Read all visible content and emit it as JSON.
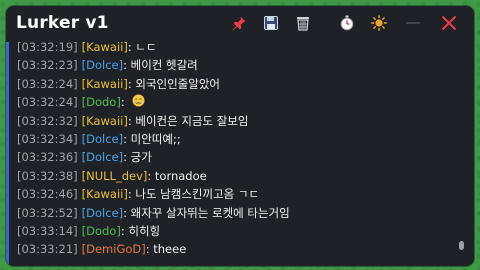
{
  "app": {
    "title": "Lurker v1"
  },
  "colors": {
    "background": "#3f9a47",
    "window": "#1e2126",
    "accent_border": "#3b63d6",
    "timestamp": "#9ea5ad",
    "users": {
      "Kawaii": "#e9c02f",
      "Dolce": "#4aa3ea",
      "Dodo": "#4cc04f",
      "NULL_dev": "#e9c02f",
      "DemiGoD": "#e8793a"
    }
  },
  "toolbar": {
    "pin": "pin-icon",
    "save": "floppy-disk-icon",
    "clear": "trash-basket-icon",
    "timer": "stopwatch-icon",
    "theme": "sun-icon",
    "minimize": "minimize-icon",
    "close": "close-icon"
  },
  "messages": [
    {
      "time": "[03:32:19]",
      "user": "[Kawaii]",
      "user_key": "Kawaii",
      "text": ": ㄴㄷ"
    },
    {
      "time": "[03:32:23]",
      "user": "[Dolce]",
      "user_key": "Dolce",
      "text": ": 베이컨 헷갈려"
    },
    {
      "time": "[03:32:24]",
      "user": "[Kawaii]",
      "user_key": "Kawaii",
      "text": ": 외국인인줄알았어"
    },
    {
      "time": "[03:32:24]",
      "user": "[Dodo]",
      "user_key": "Dodo",
      "text": ": ",
      "emoji": "crying-face-emoji"
    },
    {
      "time": "[03:32:32]",
      "user": "[Kawaii]",
      "user_key": "Kawaii",
      "text": ": 베이컨은 지금도 잘보임"
    },
    {
      "time": "[03:32:34]",
      "user": "[Dolce]",
      "user_key": "Dolce",
      "text": ": 미안띠예;;"
    },
    {
      "time": "[03:32:36]",
      "user": "[Dolce]",
      "user_key": "Dolce",
      "text": ": 긍가"
    },
    {
      "time": "[03:32:38]",
      "user": "[NULL_dev]",
      "user_key": "NULL_dev",
      "text": ": tornadoe"
    },
    {
      "time": "[03:32:46]",
      "user": "[Kawaii]",
      "user_key": "Kawaii",
      "text": ": 나도 남캠스킨끼고옴 ㄱㄷ"
    },
    {
      "time": "[03:32:52]",
      "user": "[Dolce]",
      "user_key": "Dolce",
      "text": ": 왜자꾸 살자뛰는 로켓에 타는거임"
    },
    {
      "time": "[03:33:14]",
      "user": "[Dodo]",
      "user_key": "Dodo",
      "text": ": 히히힝"
    },
    {
      "time": "[03:33:21]",
      "user": "[DemiGoD]",
      "user_key": "DemiGoD",
      "text": ": theee"
    }
  ]
}
